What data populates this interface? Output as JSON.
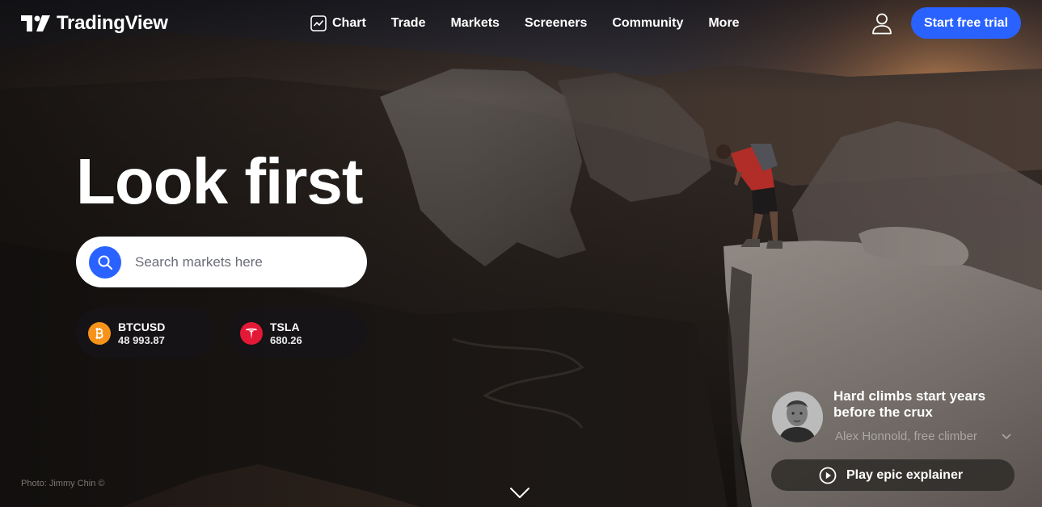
{
  "brand": {
    "name": "TradingView",
    "accent": "#2962ff"
  },
  "nav": {
    "items": [
      {
        "label": "Chart",
        "icon": "chart-icon"
      },
      {
        "label": "Trade"
      },
      {
        "label": "Markets"
      },
      {
        "label": "Screeners"
      },
      {
        "label": "Community"
      },
      {
        "label": "More"
      }
    ]
  },
  "header": {
    "user_icon": "user-icon",
    "cta_label": "Start free trial"
  },
  "hero": {
    "headline": "Look first",
    "search": {
      "placeholder": "Search markets here",
      "value": ""
    },
    "tickers": [
      {
        "symbol": "BTCUSD",
        "price": "48 993.87",
        "icon": "bitcoin-icon",
        "color": "#f7931a"
      },
      {
        "symbol": "TSLA",
        "price": "680.26",
        "icon": "tesla-icon",
        "color": "#e31937"
      }
    ],
    "photo_credit": "Photo: Jimmy Chin ©"
  },
  "quote": {
    "text": "Hard climbs start years before the crux",
    "author": "Alex Honnold, free climber",
    "play_label": "Play epic explainer"
  }
}
